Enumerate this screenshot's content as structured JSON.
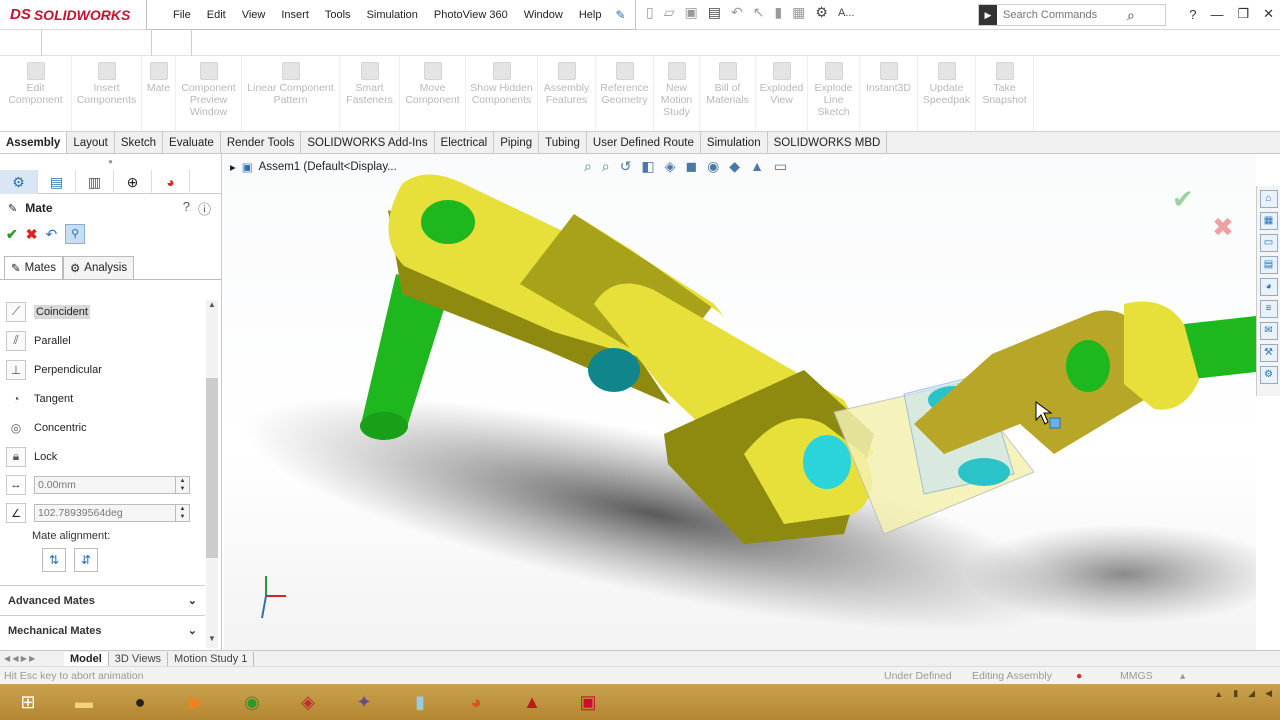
{
  "app": {
    "logo": "SOLIDWORKS",
    "logo_mark": "DS"
  },
  "menu": [
    "File",
    "Edit",
    "View",
    "Insert",
    "Tools",
    "Simulation",
    "PhotoView 360",
    "Window",
    "Help"
  ],
  "search": {
    "placeholder": "Search Commands",
    "prefix": "A..."
  },
  "commands": [
    {
      "label": "Edit Component"
    },
    {
      "label": "Insert Components"
    },
    {
      "label": "Mate"
    },
    {
      "label": "Component Preview Window"
    },
    {
      "label": "Linear Component Pattern"
    },
    {
      "label": "Smart Fasteners"
    },
    {
      "label": "Move Component"
    },
    {
      "label": "Show Hidden Components"
    },
    {
      "label": "Assembly Features"
    },
    {
      "label": "Reference Geometry"
    },
    {
      "label": "New Motion Study"
    },
    {
      "label": "Bill of Materials"
    },
    {
      "label": "Exploded View"
    },
    {
      "label": "Explode Line Sketch"
    },
    {
      "label": "Instant3D"
    },
    {
      "label": "Update Speedpak"
    },
    {
      "label": "Take Snapshot"
    }
  ],
  "tabs": [
    "Assembly",
    "Layout",
    "Sketch",
    "Evaluate",
    "Render Tools",
    "SOLIDWORKS Add-Ins",
    "Electrical",
    "Piping",
    "Tubing",
    "User Defined Route",
    "Simulation",
    "SOLIDWORKS MBD"
  ],
  "property_manager": {
    "title": "Mate",
    "subtabs": [
      "Mates",
      "Analysis"
    ],
    "mate_types": [
      "Coincident",
      "Parallel",
      "Perpendicular",
      "Tangent",
      "Concentric",
      "Lock"
    ],
    "distance_value": "0.00mm",
    "angle_value": "102.78939564deg",
    "alignment_label": "Mate alignment:",
    "advanced": "Advanced Mates",
    "mechanical": "Mechanical Mates"
  },
  "tree": {
    "label": "Assem1  (Default<Display..."
  },
  "bottom_tabs": [
    "Model",
    "3D Views",
    "Motion Study 1"
  ],
  "status": {
    "left": "Hit Esc key to abort animation",
    "state": "Under Defined",
    "mode": "Editing Assembly",
    "units": "MMGS"
  },
  "colors": {
    "yellow_part": "#e8e03a",
    "green_pin": "#1eb81e",
    "cyan_hole": "#2ac4c8",
    "accent": "#2a6fb5"
  }
}
